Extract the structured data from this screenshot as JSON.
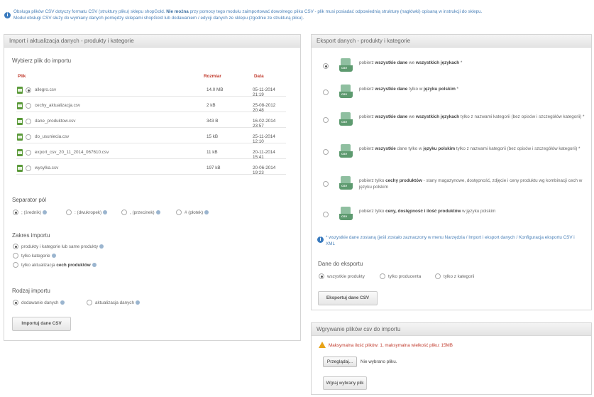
{
  "info": {
    "text_a": "Obsługa plików CSV dotyczy formatu CSV (struktury pliku) sklepu shopGold.",
    "text_b": "Nie można",
    "text_c": "przy pomocy tego modułu zaimportować dowolnego pliku CSV - plik musi posiadać odpowiednią strukturę (nagłówki) opisaną w instrukcji do sklepu.",
    "text_d": "Moduł obsługi CSV służy do wymiany danych pomiędzy sklepami shopGold lub dodawaniem / edycji danych ze sklepu (zgodnie ze strukturą pliku)."
  },
  "import_panel": {
    "title": "Import i aktualizacja danych - produkty i kategorie",
    "choose_file": "Wybierz plik do importu",
    "columns": {
      "file": "Plik",
      "size": "Rozmiar",
      "date": "Data"
    },
    "files": [
      {
        "name": "allegro.csv",
        "size": "14.0 MB",
        "date": "05-11-2014 21:19",
        "selected": true
      },
      {
        "name": "cechy_aktualizacja.csv",
        "size": "2 kB",
        "date": "25-08-2012 20:48",
        "selected": false
      },
      {
        "name": "dane_produktow.csv",
        "size": "343 B",
        "date": "16-02-2014 23:57",
        "selected": false
      },
      {
        "name": "do_usuniecia.csv",
        "size": "15 kB",
        "date": "25-11-2014 12:10",
        "selected": false
      },
      {
        "name": "export_csv_20_11_2014_067610.csv",
        "size": "11 kB",
        "date": "20-11-2014 15:41",
        "selected": false
      },
      {
        "name": "wysylka.csv",
        "size": "197 kB",
        "date": "20-06-2014 19:23",
        "selected": false
      }
    ],
    "separator_title": "Separator pól",
    "separators": [
      {
        "label": "; (średnik)",
        "selected": true
      },
      {
        "label": ": (dwukropek)",
        "selected": false
      },
      {
        "label": ", (przecinek)",
        "selected": false
      },
      {
        "label": "# (płotek)",
        "selected": false
      }
    ],
    "scope_title": "Zakres importu",
    "scope_1": "produkty i kategorie lub same produkty",
    "scope_2": "tylko kategorie",
    "scope_3a": "tylko aktualizacja",
    "scope_3b": "cech produktów",
    "type_title": "Rodzaj importu",
    "type_1": "dodawanie danych",
    "type_2": "aktualizacja danych",
    "import_button": "Importuj dane CSV"
  },
  "export_panel": {
    "title": "Eksport danych - produkty i kategorie",
    "icon_label": "CSV",
    "options": [
      {
        "pre": "pobierz ",
        "b1": "wszystkie dane",
        "mid": " we ",
        "b2": "wszystkich językach",
        "post": " *",
        "selected": true
      },
      {
        "pre": "pobierz ",
        "b1": "wszystkie dane",
        "mid": " tylko w ",
        "b2": "języku polskim",
        "post": " *",
        "selected": false
      },
      {
        "pre": "pobierz ",
        "b1": "wszystkie dane",
        "mid": " we ",
        "b2": "wszystkich językach",
        "post": " tylko z nazwami kategorii (bez opisów i szczegółów kategorii) *",
        "selected": false
      },
      {
        "pre": "pobierz ",
        "b1": "wszystkie",
        "mid": " dane tylko w ",
        "b2": "języku polskim",
        "post": " tylko z nazwami kategorii (bez opisów i szczegółów kategorii) *",
        "selected": false
      },
      {
        "pre": "pobierz tylko ",
        "b1": "cechy produktów",
        "mid": " - stany magazynowe, dostępność, zdjęcie i ceny produktu wg kombinacji cech w języku polskim",
        "b2": "",
        "post": "",
        "selected": false
      },
      {
        "pre": "pobierz tylko ",
        "b1": "ceny, dostępność i ilość produktów",
        "mid": " w języku polskim",
        "b2": "",
        "post": "",
        "selected": false
      }
    ],
    "note": "* wszystkie dane zostaną (jeśli zostało zaznaczony w menu Narzędzia / Import i eksport danych / Konfiguracja eksportu CSV i XML",
    "data_title": "Dane do eksportu",
    "data_opts": [
      {
        "label": "wszystkie produkty",
        "selected": true
      },
      {
        "label": "tylko producenta",
        "selected": false
      },
      {
        "label": "tylko z kategorii",
        "selected": false
      }
    ],
    "export_button": "Eksportuj dane CSV"
  },
  "upload_panel": {
    "title": "Wgrywanie plików csv do importu",
    "warning": "Maksymalna ilość plików: 1, maksymalna wielkość pliku: 15MB",
    "browse_button": "Przeglądaj...",
    "no_file": "Nie wybrano pliku.",
    "upload_button": "Wgraj wybrany plik"
  }
}
